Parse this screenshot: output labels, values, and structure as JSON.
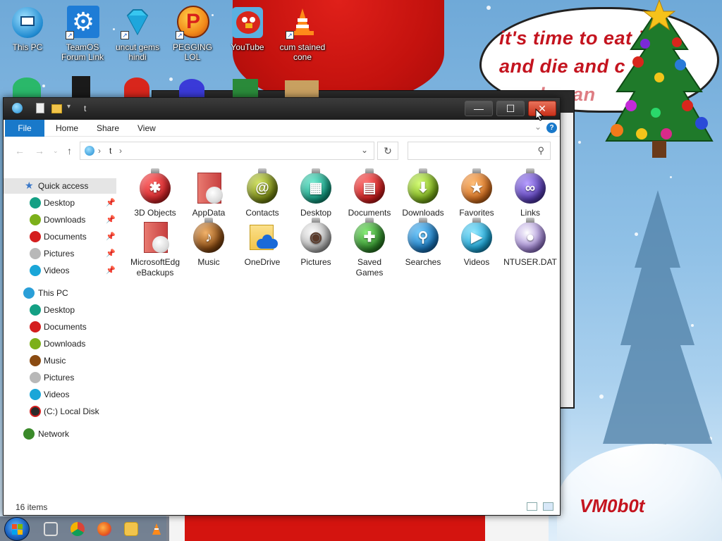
{
  "desktop": {
    "icons": [
      {
        "label": "This PC",
        "icon": "this-pc-icon",
        "color": "#2a9fd8"
      },
      {
        "label": "TeamOS Forum Link",
        "icon": "gear-icon",
        "color": "#1e7cd6"
      },
      {
        "label": "uncut gems hindi",
        "icon": "gem-icon",
        "color": "#38c6f0"
      },
      {
        "label": "PEGGING LOL",
        "icon": "p-logo-icon",
        "color": "#e24b1f"
      },
      {
        "label": "YouTube",
        "icon": "angry-bird-icon",
        "color": "#d8261c"
      },
      {
        "label": "cum stained cone",
        "icon": "traffic-cone-icon",
        "color": "#ff8a1a"
      }
    ],
    "wallpaper_text": "it's time to eat it and die and candy cane",
    "wallpaper_line1": "it's time to eat it",
    "wallpaper_line2": "and die and c",
    "wallpaper_line3": "candy can",
    "watermark": "VM0b0t"
  },
  "window": {
    "title": "t",
    "ribbon_tabs": [
      "File",
      "Home",
      "Share",
      "View"
    ],
    "help_label": "?",
    "address": {
      "segments": [
        "t"
      ]
    },
    "search": {
      "placeholder": ""
    },
    "nav": {
      "quick_access": "Quick access",
      "quick_items": [
        "Desktop",
        "Downloads",
        "Documents",
        "Pictures",
        "Videos"
      ],
      "this_pc": "This PC",
      "pc_items": [
        "Desktop",
        "Documents",
        "Downloads",
        "Music",
        "Pictures",
        "Videos",
        "(C:) Local Disk"
      ],
      "network": "Network"
    },
    "items": [
      {
        "label": "3D Objects",
        "icon": "3d-objects-icon",
        "color": "#d8262a",
        "glyph": "✱"
      },
      {
        "label": "AppData",
        "icon": "folder-icon",
        "color": "#d94b45",
        "glyph": ""
      },
      {
        "label": "Contacts",
        "icon": "contacts-icon",
        "color": "#7a8a14",
        "glyph": "@"
      },
      {
        "label": "Desktop",
        "icon": "desktop-icon",
        "color": "#14a084",
        "glyph": "▦"
      },
      {
        "label": "Documents",
        "icon": "documents-icon",
        "color": "#d41e1e",
        "glyph": "▤"
      },
      {
        "label": "Downloads",
        "icon": "downloads-icon",
        "color": "#7cb01a",
        "glyph": "⬇"
      },
      {
        "label": "Favorites",
        "icon": "favorites-icon",
        "color": "#d8701e",
        "glyph": "★"
      },
      {
        "label": "Links",
        "icon": "links-icon",
        "color": "#5a3fb8",
        "glyph": "∞"
      },
      {
        "label": "MicrosoftEdgeBackups",
        "icon": "folder-icon",
        "color": "#d94b45",
        "glyph": ""
      },
      {
        "label": "Music",
        "icon": "music-icon",
        "color": "#8a4b12",
        "glyph": "♪"
      },
      {
        "label": "OneDrive",
        "icon": "onedrive-icon",
        "color": "#f2c44b",
        "glyph": ""
      },
      {
        "label": "Pictures",
        "icon": "pictures-icon",
        "color": "#b8b8b8",
        "glyph": "◉"
      },
      {
        "label": "Saved Games",
        "icon": "saved-games-icon",
        "color": "#2f8a2a",
        "glyph": "✚"
      },
      {
        "label": "Searches",
        "icon": "searches-icon",
        "color": "#1a7ac2",
        "glyph": "⚲"
      },
      {
        "label": "Videos",
        "icon": "videos-icon",
        "color": "#1aa6d8",
        "glyph": "▶"
      },
      {
        "label": "NTUSER.DAT",
        "icon": "system-file-icon",
        "color": "#a58ad8",
        "glyph": "●"
      }
    ],
    "status": {
      "count": "16 items"
    }
  },
  "taskbar": {
    "items": [
      {
        "icon": "start-orb-icon"
      },
      {
        "icon": "task-view-icon"
      },
      {
        "icon": "chrome-icon"
      },
      {
        "icon": "firefox-icon"
      },
      {
        "icon": "file-explorer-icon"
      },
      {
        "icon": "vlc-icon"
      }
    ]
  }
}
